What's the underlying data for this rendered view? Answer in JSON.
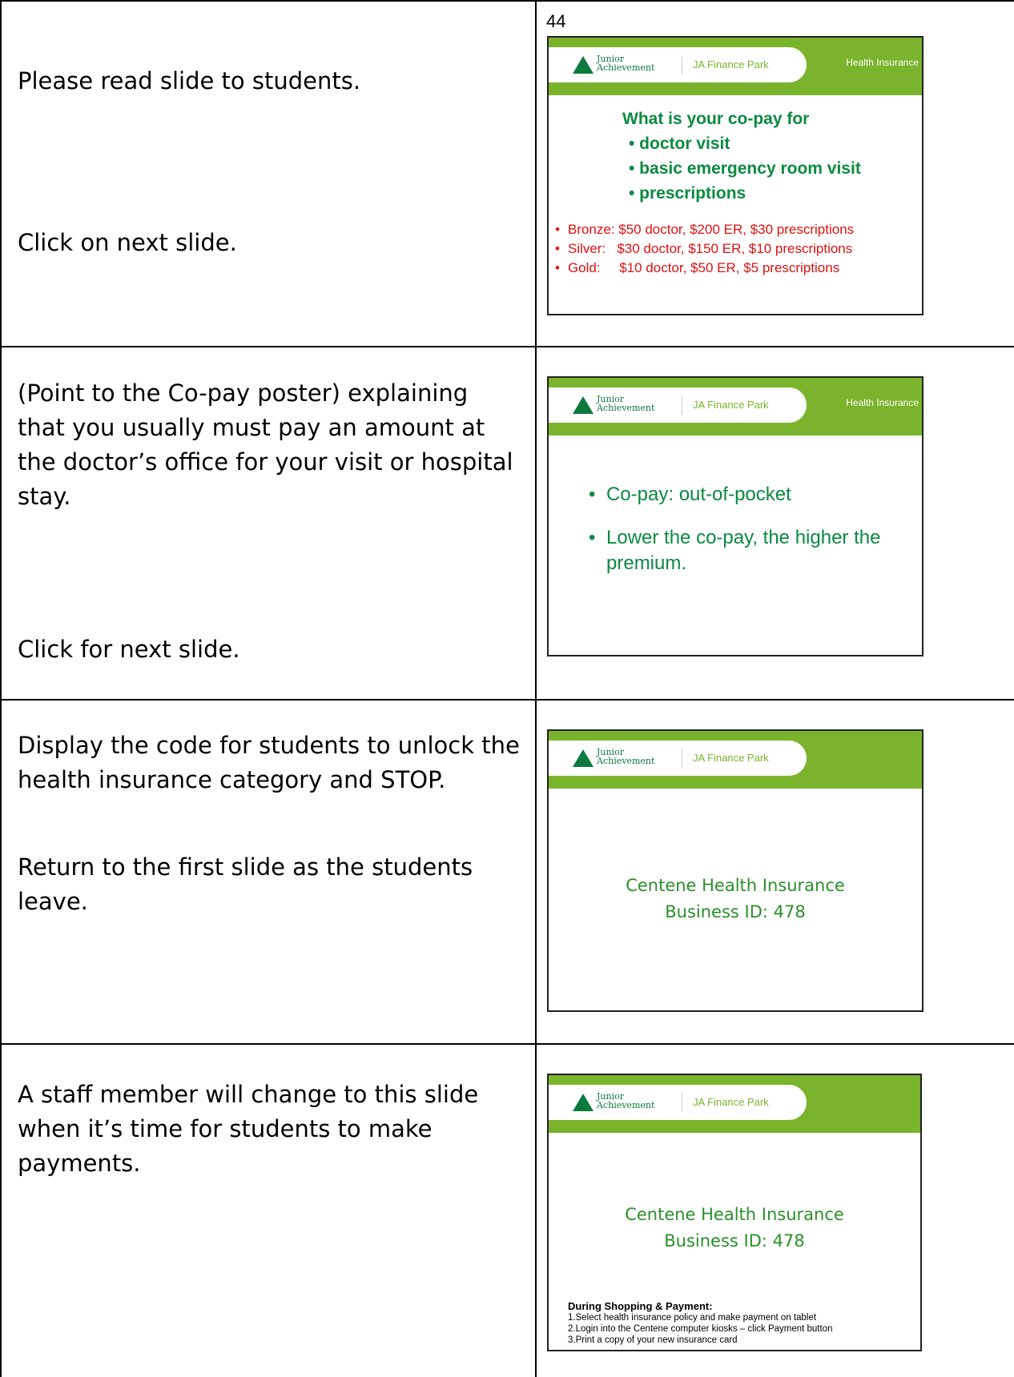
{
  "page_number": "44",
  "rows": [
    {
      "instructions": [
        "Please read slide to students.",
        "Click on next slide."
      ],
      "slide": {
        "logo_line1": "Junior",
        "logo_line2": "Achievement",
        "brand": "JA Finance Park",
        "header_right": "Health Insurance",
        "heading": "What is your co-pay for",
        "heading_items": [
          "• doctor visit",
          "• basic emergency room visit",
          "• prescriptions"
        ],
        "plans": [
          "Bronze: $50 doctor, $200 ER, $30 prescriptions",
          "Silver:   $30 doctor, $150 ER, $10 prescriptions",
          "Gold:     $10 doctor, $50 ER, $5 prescriptions"
        ]
      }
    },
    {
      "instructions": [
        "(Point to the Co-pay poster) explaining that you usually must pay an amount at the doctor’s office for your visit or hospital stay.",
        "Click for next slide."
      ],
      "slide": {
        "logo_line1": "Junior",
        "logo_line2": "Achievement",
        "brand": "JA Finance Park",
        "header_right": "Health Insurance",
        "bullets": [
          "Co-pay: out-of-pocket",
          "Lower the co-pay, the higher the premium."
        ]
      }
    },
    {
      "instructions": [
        "Display the code for students to unlock the health insurance category and STOP.",
        "Return to the first slide as the students leave."
      ],
      "slide": {
        "logo_line1": "Junior",
        "logo_line2": "Achievement",
        "brand": "JA Finance Park",
        "line1": "Centene Health Insurance",
        "line2": "Business ID: 478"
      }
    },
    {
      "instructions": [
        "A staff member will change to this slide when it’s time for students to make payments."
      ],
      "slide": {
        "logo_line1": "Junior",
        "logo_line2": "Achievement",
        "brand": "JA Finance Park",
        "line1": "Centene Health Insurance",
        "line2": "Business ID: 478",
        "steps_heading": "During Shopping & Payment:",
        "steps": [
          "1.Select health insurance policy and make payment on tablet",
          "2.Login into the Centene computer kiosks – click Payment button",
          "3.Print a copy of your new insurance card"
        ]
      }
    }
  ]
}
